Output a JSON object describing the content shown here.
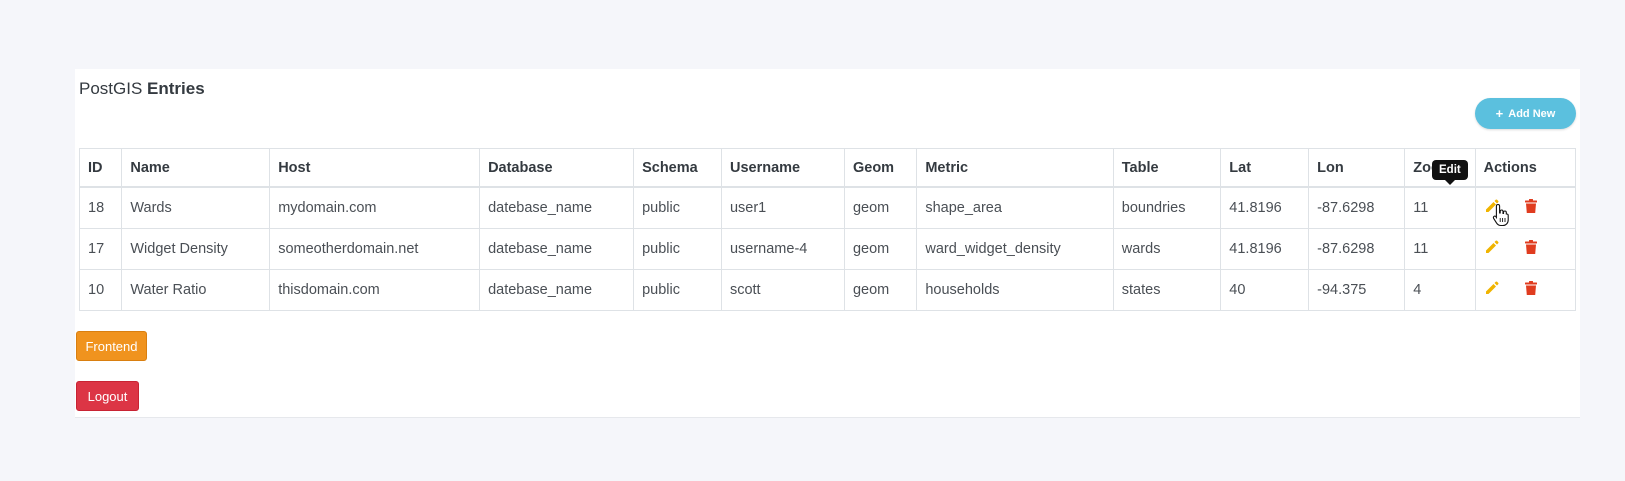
{
  "header": {
    "title_prefix": "PostGIS",
    "title_strong": "Entries",
    "add_new_label": "Add New"
  },
  "table": {
    "columns": [
      "ID",
      "Name",
      "Host",
      "Database",
      "Schema",
      "Username",
      "Geom",
      "Metric",
      "Table",
      "Lat",
      "Lon",
      "Zoom",
      "Actions"
    ],
    "rows": [
      {
        "id": "18",
        "name": "Wards",
        "host": "mydomain.com",
        "database": "datebase_name",
        "schema": "public",
        "username": "user1",
        "geom": "geom",
        "metric": "shape_area",
        "table": "boundries",
        "lat": "41.8196",
        "lon": "-87.6298",
        "zoom": "11"
      },
      {
        "id": "17",
        "name": "Widget Density",
        "host": "someotherdomain.net",
        "database": "datebase_name",
        "schema": "public",
        "username": "username-4",
        "geom": "geom",
        "metric": "ward_widget_density",
        "table": "wards",
        "lat": "41.8196",
        "lon": "-87.6298",
        "zoom": "11"
      },
      {
        "id": "10",
        "name": "Water Ratio",
        "host": "thisdomain.com",
        "database": "datebase_name",
        "schema": "public",
        "username": "scott",
        "geom": "geom",
        "metric": "households",
        "table": "states",
        "lat": "40",
        "lon": "-94.375",
        "zoom": "4"
      }
    ]
  },
  "tooltip": {
    "text": "Edit"
  },
  "buttons": {
    "frontend_label": "Frontend",
    "logout_label": "Logout"
  },
  "icons": {
    "edit": "pencil-icon",
    "delete": "trash-icon",
    "add": "plus-icon",
    "cursor": "hand-pointer-icon"
  },
  "colors": {
    "edit_icon": "#f0b400",
    "delete_icon": "#e03c1f",
    "add_button": "#5bc0de",
    "frontend_button": "#f0931e",
    "logout_button": "#dc3545"
  }
}
